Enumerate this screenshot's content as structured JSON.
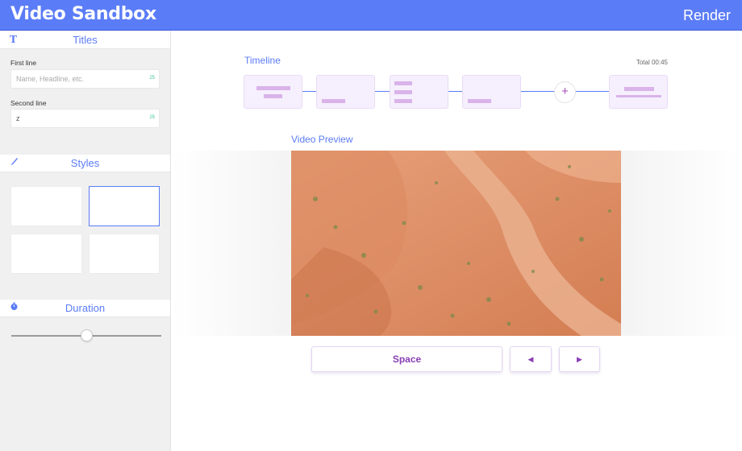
{
  "header": {
    "title": "Video Sandbox",
    "render_label": "Render",
    "accent_color": "#5b7cf7"
  },
  "sidebar": {
    "titles": {
      "heading": "Titles",
      "icon": "text-t-icon",
      "first_line": {
        "label": "First line",
        "value": "",
        "placeholder": "Name, Headline, etc.",
        "counter": "25"
      },
      "second_line": {
        "label": "Second line",
        "value": "z",
        "placeholder": "",
        "counter": "25"
      }
    },
    "styles": {
      "heading": "Styles",
      "icon": "brush-icon",
      "cards": 4,
      "selected_index": 1
    },
    "duration": {
      "heading": "Duration",
      "icon": "stopwatch-icon",
      "slider_fraction": 0.5
    }
  },
  "timeline": {
    "heading": "Timeline",
    "total": "Total 00:45",
    "add_label": "+",
    "clip_color": "#f6effd",
    "bar_color": "#d9b3e9"
  },
  "preview": {
    "heading": "Video Preview"
  },
  "controls": {
    "space_label": "Space",
    "prev_icon": "play-left-icon",
    "next_icon": "play-right-icon",
    "prev_glyph": "◀",
    "next_glyph": "▶"
  }
}
